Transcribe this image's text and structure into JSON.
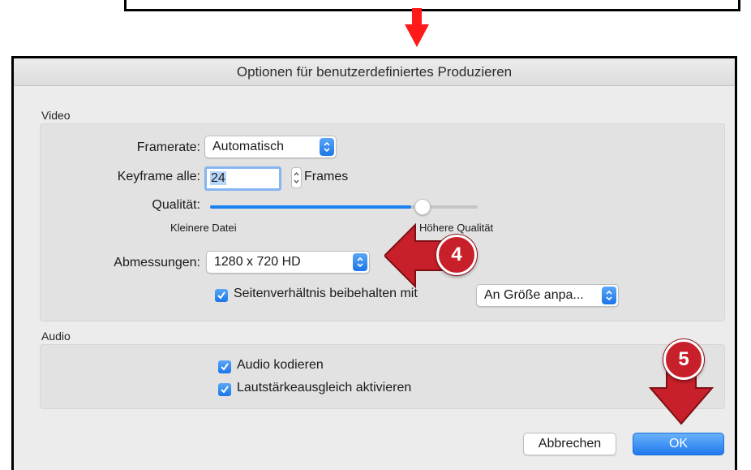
{
  "dialog": {
    "title": "Optionen für benutzerdefiniertes Produzieren"
  },
  "video": {
    "section_label": "Video",
    "framerate_label": "Framerate:",
    "framerate_value": "Automatisch",
    "keyframe_label": "Keyframe alle:",
    "keyframe_value": "24",
    "keyframe_unit": "Frames",
    "quality_label": "Qualität:",
    "quality_min_label": "Kleinere Datei",
    "quality_max_label": "Höhere Qualität",
    "quality_level": 0.75,
    "dimensions_label": "Abmessungen:",
    "dimensions_value": "1280 x 720 HD",
    "aspect_checkbox_label": "Seitenverhältnis beibehalten mit",
    "aspect_checked": true,
    "aspect_mode_value": "An Größe anpa..."
  },
  "audio": {
    "section_label": "Audio",
    "encode_label": "Audio kodieren",
    "encode_checked": true,
    "normalize_label": "Lautstärkeausgleich aktivieren",
    "normalize_checked": true
  },
  "buttons": {
    "cancel_label": "Abbrechen",
    "ok_label": "OK"
  },
  "callouts": {
    "step_4": "4",
    "step_5": "5"
  },
  "colors": {
    "accent": "#1a82f0",
    "callout_red": "#c8202a",
    "arrow_red": "#ff1a1a"
  }
}
